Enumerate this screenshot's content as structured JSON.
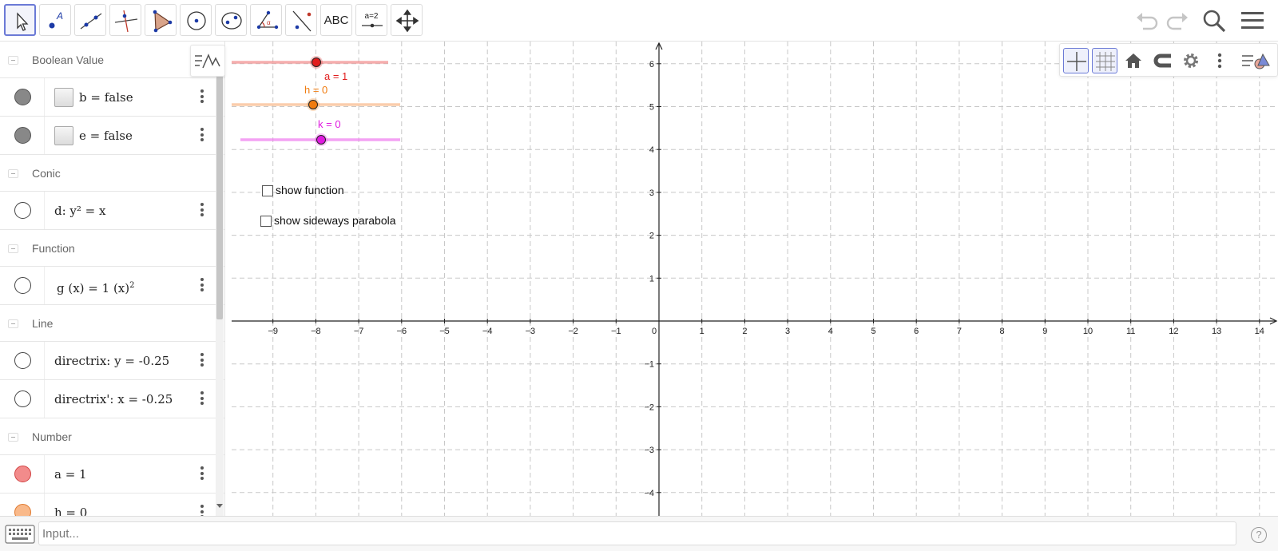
{
  "toolbar": {
    "tools": [
      {
        "name": "move-tool",
        "icon": "arrow-pointer-icon"
      },
      {
        "name": "point-tool",
        "icon": "point-icon"
      },
      {
        "name": "line-tool",
        "icon": "line-icon"
      },
      {
        "name": "perpendicular-tool",
        "icon": "perpendicular-icon"
      },
      {
        "name": "polygon-tool",
        "icon": "polygon-icon"
      },
      {
        "name": "circle-tool",
        "icon": "circle-center-icon"
      },
      {
        "name": "ellipse-tool",
        "icon": "ellipse-icon"
      },
      {
        "name": "angle-tool",
        "icon": "angle-icon"
      },
      {
        "name": "reflect-tool",
        "icon": "reflect-icon"
      },
      {
        "name": "text-tool",
        "icon": "text-icon",
        "label": "ABC"
      },
      {
        "name": "slider-tool",
        "icon": "slider-icon",
        "label": "a=2"
      },
      {
        "name": "move-graphics-tool",
        "icon": "move-arrows-icon"
      }
    ],
    "right_buttons": [
      "undo-icon",
      "redo-icon",
      "search-icon",
      "menu-icon"
    ]
  },
  "algebra": {
    "categories": {
      "boolean": "Boolean Value",
      "conic": "Conic",
      "function": "Function",
      "line": "Line",
      "number": "Number"
    },
    "rows": {
      "b": "b = false",
      "e": "e = false",
      "d": "d: y² = x",
      "g": "g (x) = 1 (x)",
      "g_sup": "2",
      "directrix": "directrix: y = -0.25",
      "directrix2": "directrix': x = -0.25",
      "a": "a = 1",
      "h": "h = 0"
    }
  },
  "graphics": {
    "x_ticks": [
      "−9",
      "−8",
      "−7",
      "−6",
      "−5",
      "−4",
      "−3",
      "−2",
      "−1",
      "0",
      "1",
      "2",
      "3",
      "4",
      "5",
      "6",
      "7",
      "8",
      "9",
      "10",
      "11",
      "12",
      "13",
      "14"
    ],
    "y_ticks_pos": [
      "6",
      "5",
      "4",
      "3",
      "2",
      "1"
    ],
    "y_ticks_neg": [
      "−1",
      "−2",
      "−3",
      "−4"
    ],
    "sliders": {
      "a": {
        "label": "a = 1",
        "color": "#e11d1d",
        "value": 1
      },
      "h": {
        "label": "h = 0",
        "color": "#f07c10",
        "value": 0
      },
      "k": {
        "label": "k = 0",
        "color": "#e01ae0",
        "value": 0
      }
    },
    "checkboxes": {
      "show_function": "show function",
      "show_sideways": "show sideways parabola"
    }
  },
  "input": {
    "placeholder": "Input...",
    "help": "?"
  },
  "colors": {
    "accent": "#6b7ad6",
    "a": "#f28b8b",
    "h": "#f9b98a"
  }
}
